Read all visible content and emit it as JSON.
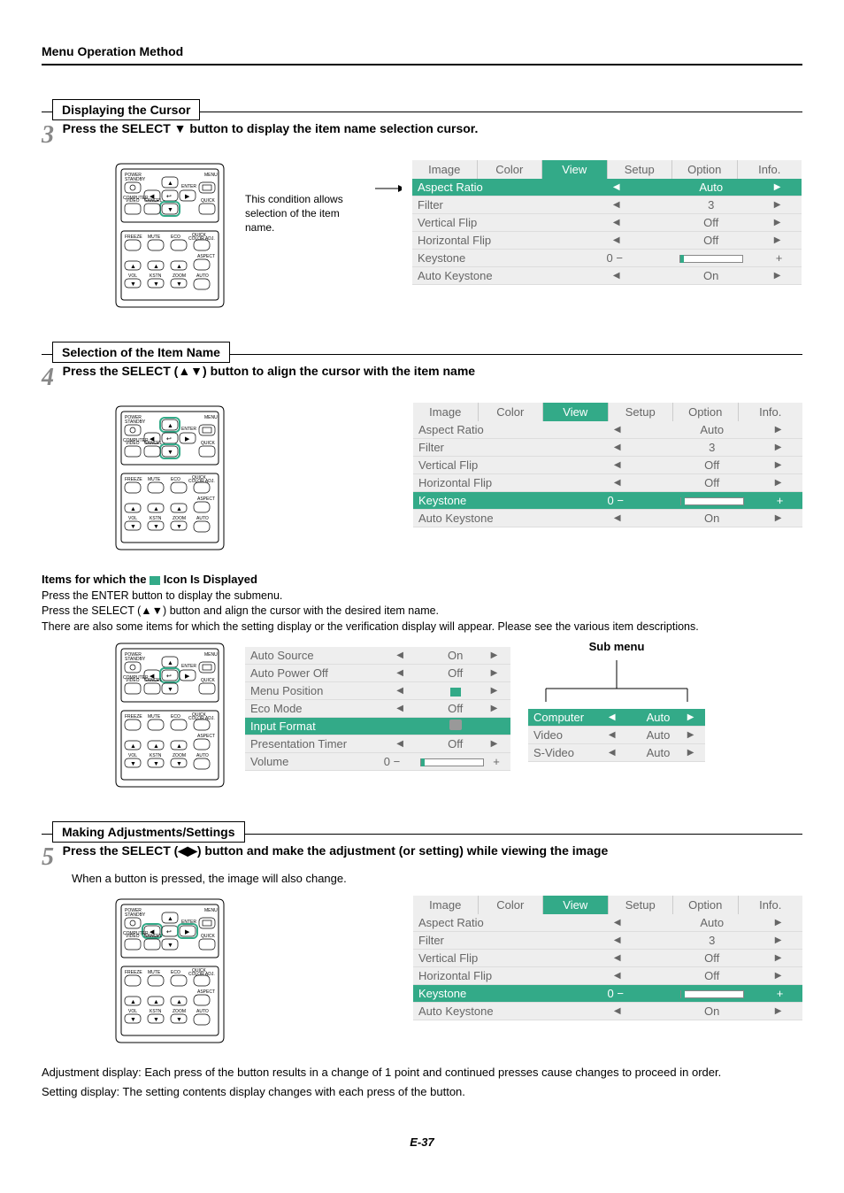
{
  "header": "Menu Operation Method",
  "section1": {
    "title": "Displaying the Cursor"
  },
  "step3": {
    "num": "3",
    "text": "Press the SELECT ▼ button to display the item name selection cursor.",
    "caption": "This condition allows selection of the item name."
  },
  "section2": {
    "title": "Selection of the Item Name"
  },
  "step4": {
    "num": "4",
    "text": "Press the SELECT (▲▼) button to align the cursor with the item name"
  },
  "notes": {
    "title_pre": "Items for which the ",
    "title_post": " Icon Is Displayed",
    "l1": "Press the ENTER button to display the submenu.",
    "l2": "Press the SELECT (▲▼) button and align the cursor with the desired item name.",
    "l3": "There are also some items for which the setting display or the verification display will appear. Please see the various item descriptions."
  },
  "submenu_label": "Sub menu",
  "section3": {
    "title": "Making Adjustments/Settings"
  },
  "step5": {
    "num": "5",
    "text": "Press the SELECT (◀▶) button and make the adjustment (or setting) while viewing the image",
    "sub": "When a button is pressed, the image will also change."
  },
  "body1": "Adjustment display: Each press of the button results in a change of 1 point and continued presses cause changes to proceed in order.",
  "body2": "Setting display: The setting contents display changes with each press of the button.",
  "page_footer": "E-37",
  "tabs": [
    "Image",
    "Color",
    "View",
    "Setup",
    "Option",
    "Info."
  ],
  "viewmenu": [
    {
      "label": "Aspect Ratio",
      "val": "Auto",
      "type": "lr"
    },
    {
      "label": "Filter",
      "val": "3",
      "type": "lr"
    },
    {
      "label": "Vertical Flip",
      "val": "Off",
      "type": "lr"
    },
    {
      "label": "Horizontal Flip",
      "val": "Off",
      "type": "lr"
    },
    {
      "label": "Keystone",
      "val": "0",
      "type": "slider"
    },
    {
      "label": "Auto Keystone",
      "val": "On",
      "type": "lr"
    }
  ],
  "setupmenu": [
    {
      "label": "Auto Source",
      "val": "On",
      "type": "lr"
    },
    {
      "label": "Auto Power Off",
      "val": "Off",
      "type": "lr"
    },
    {
      "label": "Menu Position",
      "val": "",
      "type": "pos"
    },
    {
      "label": "Eco Mode",
      "val": "Off",
      "type": "lr"
    },
    {
      "label": "Input Format",
      "val": "",
      "type": "enter"
    },
    {
      "label": "Presentation Timer",
      "val": "Off",
      "type": "lr"
    },
    {
      "label": "Volume",
      "val": "0",
      "type": "slider"
    }
  ],
  "inputsub": [
    {
      "label": "Computer",
      "val": "Auto"
    },
    {
      "label": "Video",
      "val": "Auto"
    },
    {
      "label": "S-Video",
      "val": "Auto"
    }
  ],
  "remote": {
    "labels": {
      "power": "POWER\nSTANDBY",
      "menu": "MENU",
      "computer": "COMPUTER",
      "enter": "ENTER",
      "video": "VIDEO",
      "cancel": "CANCEL",
      "quick": "QUICK",
      "freeze": "FREEZE",
      "mute": "MUTE",
      "eco": "ECO",
      "qca": "QUICK\nCOLOR ADJ.",
      "aspect": "ASPECT",
      "vol": "VOL",
      "kstn": "KSTN",
      "zoom": "ZOOM",
      "auto": "AUTO"
    }
  }
}
